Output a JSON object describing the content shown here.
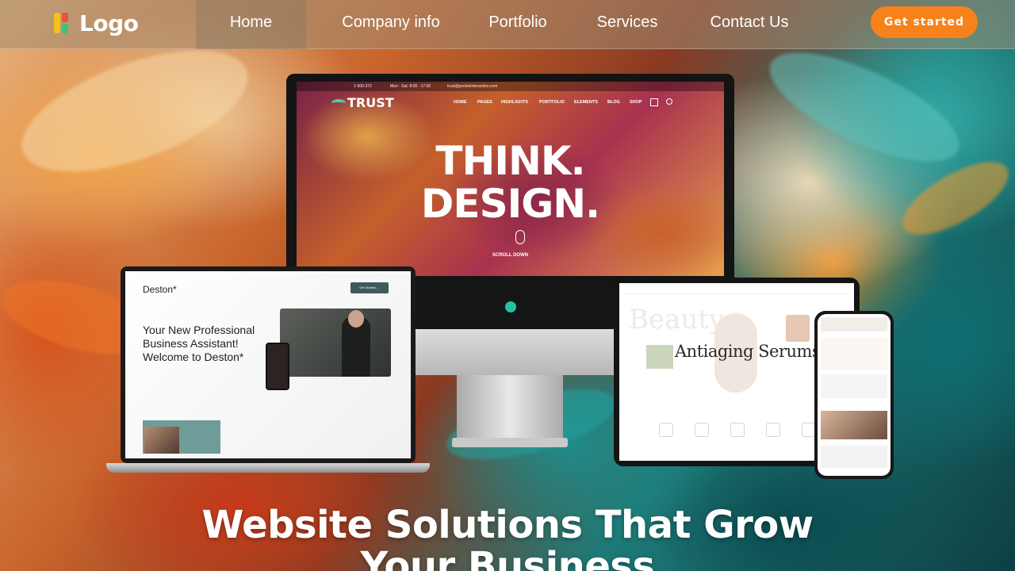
{
  "brand": {
    "logo_text": "Logo"
  },
  "nav": {
    "items": [
      {
        "label": "Home",
        "active": true
      },
      {
        "label": "Company info",
        "active": false
      },
      {
        "label": "Portfolio",
        "active": false
      },
      {
        "label": "Services",
        "active": false
      },
      {
        "label": "Contact Us",
        "active": false
      }
    ],
    "cta_label": "Get started"
  },
  "mockups": {
    "monitor": {
      "topbar_phone": "1-500-372",
      "topbar_hours": "Mon - Sat: 8:00 - 17:00",
      "topbar_email": "trust@pocketinteraction.com",
      "brand": "TRUST",
      "links": [
        "HOME",
        "PAGES",
        "HIGHLIGHTS",
        "PORTFOLIO",
        "ELEMENTS",
        "BLOG",
        "SHOP"
      ],
      "hero_line1": "THINK.",
      "hero_line2": "DESIGN.",
      "scroll_label": "SCROLL DOWN"
    },
    "laptop": {
      "brand": "Deston*",
      "button_label": "Get Started  →",
      "headline": "Your New Professional Business Assistant! Welcome to Deston*"
    },
    "tablet": {
      "ghost_text": "Beauty",
      "title": "Antiaging Serums"
    }
  },
  "hero": {
    "headline_line1": "Website Solutions That Grow",
    "headline_line2": "Your Business"
  },
  "colors": {
    "accent": "#f7821b",
    "header_bg": "rgba(160,140,115,0.55)",
    "monitor_dot": "#22c4a0",
    "laptop_accent": "#3f5b59"
  }
}
